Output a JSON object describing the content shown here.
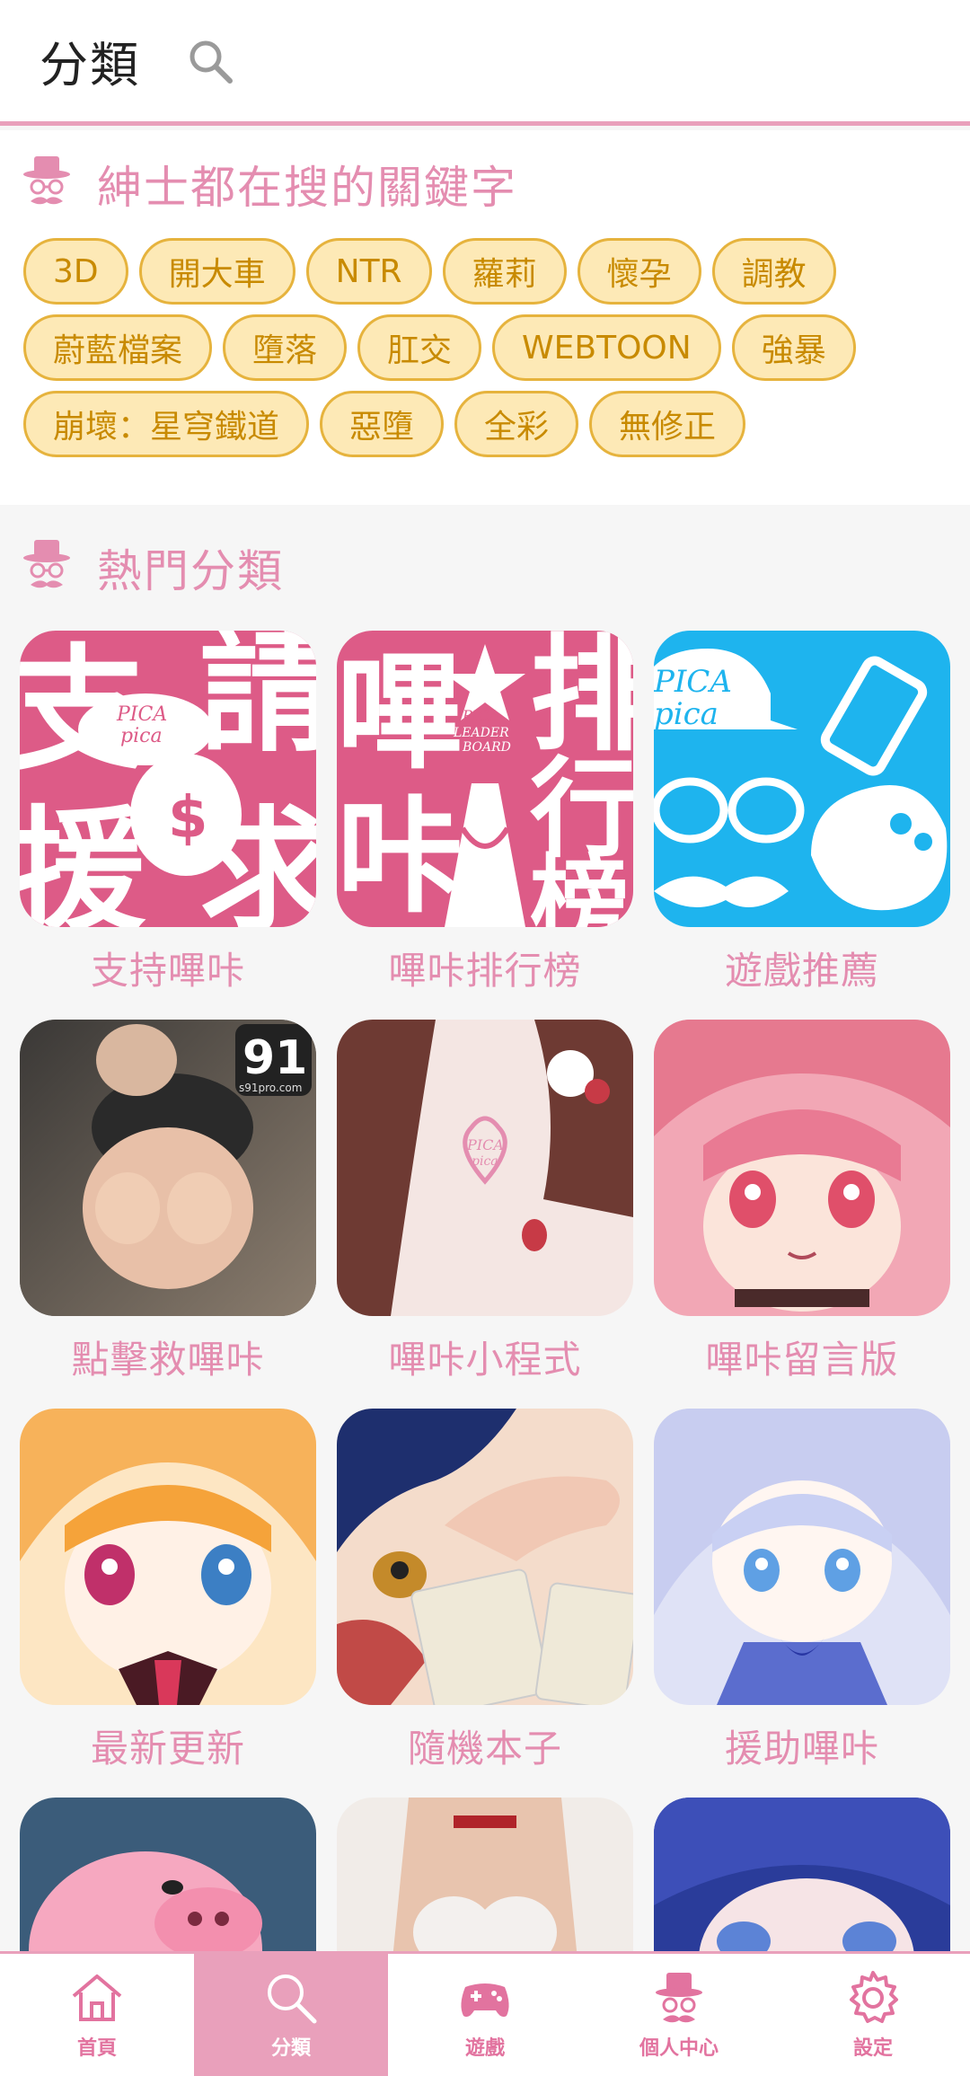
{
  "header": {
    "title": "分類",
    "search_icon": "search-icon"
  },
  "keywords": {
    "title": "紳士都在搜的關鍵字",
    "tags": [
      "3D",
      "開大車",
      "NTR",
      "蘿莉",
      "懷孕",
      "調教",
      "蔚藍檔案",
      "墮落",
      "肛交",
      "WEBTOON",
      "強暴",
      "崩壞：星穹鐵道",
      "惡墮",
      "全彩",
      "無修正"
    ]
  },
  "hot": {
    "title": "熱門分類",
    "items": [
      {
        "label": "支持嗶咔",
        "thumb_text": [
          "支",
          "請",
          "援",
          "求",
          "PICA",
          "pica",
          "$"
        ]
      },
      {
        "label": "嗶咔排行榜",
        "thumb_text": [
          "嗶",
          "排",
          "咔",
          "行",
          "榜",
          "PICA",
          "LEADER",
          "BOARD"
        ]
      },
      {
        "label": "遊戲推薦",
        "thumb_text": [
          "PICA",
          "pica"
        ]
      },
      {
        "label": "點擊救嗶咔",
        "thumb_text": [
          "91",
          "s91pro.com"
        ]
      },
      {
        "label": "嗶咔小程式",
        "thumb_text": [
          "PICA",
          "pica"
        ]
      },
      {
        "label": "嗶咔留言版",
        "thumb_text": []
      },
      {
        "label": "最新更新",
        "thumb_text": []
      },
      {
        "label": "隨機本子",
        "thumb_text": []
      },
      {
        "label": "援助嗶咔",
        "thumb_text": []
      },
      {
        "label": "",
        "thumb_text": []
      },
      {
        "label": "",
        "thumb_text": []
      },
      {
        "label": "",
        "thumb_text": []
      }
    ]
  },
  "nav": {
    "items": [
      {
        "label": "首頁",
        "icon": "home-icon",
        "active": false
      },
      {
        "label": "分類",
        "icon": "search-icon",
        "active": true
      },
      {
        "label": "遊戲",
        "icon": "gamepad-icon",
        "active": false
      },
      {
        "label": "個人中心",
        "icon": "hat-icon",
        "active": false
      },
      {
        "label": "設定",
        "icon": "gear-icon",
        "active": false
      }
    ]
  },
  "colors": {
    "accent": "#e48db0",
    "chip_bg": "#fde9b6",
    "chip_border": "#e6b33d",
    "chip_text": "#c88a00"
  }
}
